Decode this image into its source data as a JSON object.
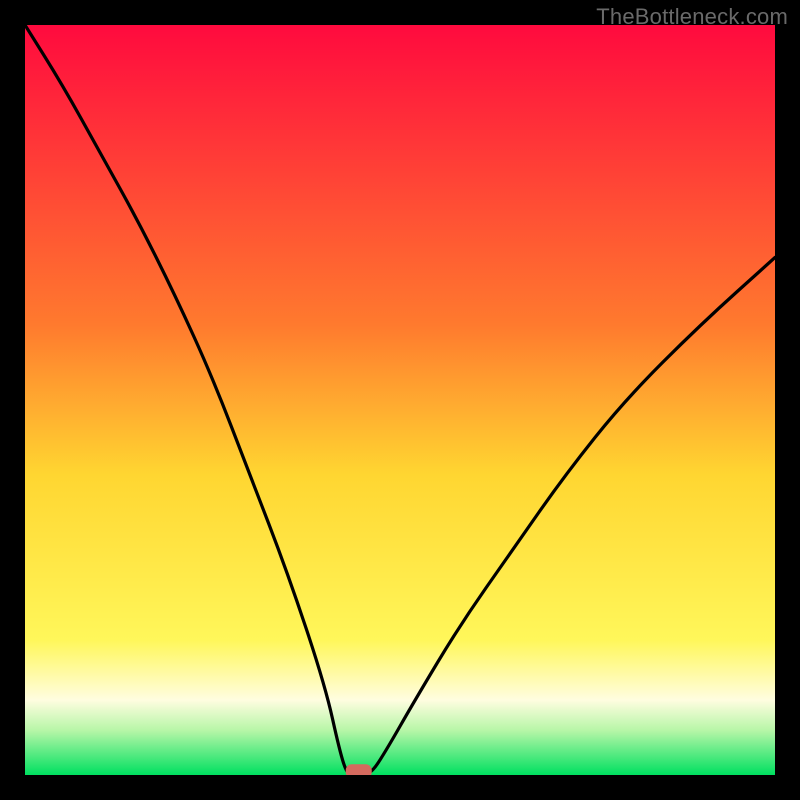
{
  "watermark": "TheBottleneck.com",
  "chart_data": {
    "type": "line",
    "title": "",
    "xlabel": "",
    "ylabel": "",
    "xlim": [
      0,
      100
    ],
    "ylim": [
      0,
      100
    ],
    "axis_ticks_visible": false,
    "grid": false,
    "background_gradient": [
      {
        "y": 100,
        "color": "#ff0a3e"
      },
      {
        "y": 60,
        "color": "#ff7a2e"
      },
      {
        "y": 40,
        "color": "#ffd631"
      },
      {
        "y": 18,
        "color": "#fff75a"
      },
      {
        "y": 10,
        "color": "#fffde0"
      },
      {
        "y": 6,
        "color": "#b8f6a8"
      },
      {
        "y": 0,
        "color": "#00e060"
      }
    ],
    "curve": {
      "minimum_x": 44,
      "minimum_y": 0,
      "points": [
        {
          "x": 0,
          "y": 100
        },
        {
          "x": 5,
          "y": 92
        },
        {
          "x": 10,
          "y": 83
        },
        {
          "x": 15,
          "y": 74
        },
        {
          "x": 20,
          "y": 64
        },
        {
          "x": 25,
          "y": 53
        },
        {
          "x": 30,
          "y": 40
        },
        {
          "x": 35,
          "y": 27
        },
        {
          "x": 40,
          "y": 12
        },
        {
          "x": 42,
          "y": 3
        },
        {
          "x": 43,
          "y": 0
        },
        {
          "x": 44,
          "y": 0
        },
        {
          "x": 46,
          "y": 0
        },
        {
          "x": 48,
          "y": 3
        },
        {
          "x": 52,
          "y": 10
        },
        {
          "x": 58,
          "y": 20
        },
        {
          "x": 65,
          "y": 30
        },
        {
          "x": 72,
          "y": 40
        },
        {
          "x": 80,
          "y": 50
        },
        {
          "x": 90,
          "y": 60
        },
        {
          "x": 100,
          "y": 69
        }
      ]
    },
    "marker": {
      "x": 44.5,
      "y": 0.5,
      "shape": "rounded-rect",
      "color": "#d46a5e"
    }
  }
}
